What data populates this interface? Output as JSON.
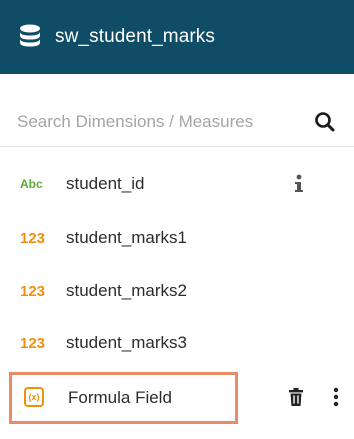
{
  "header": {
    "icon": "database-icon",
    "title": "sw_student_marks",
    "background": "#0f4d66"
  },
  "search": {
    "placeholder": "Search Dimensions / Measures",
    "value": "",
    "icon": "search-icon"
  },
  "fields": [
    {
      "type_badge": "Abc",
      "label": "student_id",
      "kind": "dimension",
      "icon": "info-icon"
    },
    {
      "type_badge": "123",
      "label": "student_marks1",
      "kind": "measure"
    },
    {
      "type_badge": "123",
      "label": "student_marks2",
      "kind": "measure"
    },
    {
      "type_badge": "123",
      "label": "student_marks3",
      "kind": "measure"
    }
  ],
  "formula_field": {
    "badge": "(x)",
    "label": "Formula Field",
    "highlight_color": "#eb8a66",
    "icons": [
      "trash-icon",
      "more-vertical-icon"
    ]
  },
  "colors": {
    "dimension": "#5aab38",
    "measure": "#f0900f"
  }
}
